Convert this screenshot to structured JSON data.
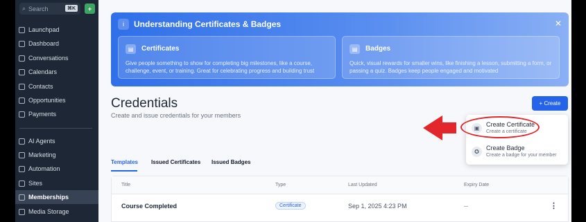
{
  "sidebar": {
    "search_placeholder": "Search",
    "search_shortcut": "⌘K",
    "add_button": "+",
    "items": [
      {
        "label": "Launchpad",
        "icon": "rocket-icon"
      },
      {
        "label": "Dashboard",
        "icon": "dashboard-icon"
      },
      {
        "label": "Conversations",
        "icon": "chat-icon"
      },
      {
        "label": "Calendars",
        "icon": "calendar-icon"
      },
      {
        "label": "Contacts",
        "icon": "contacts-icon"
      },
      {
        "label": "Opportunities",
        "icon": "opportunities-icon"
      },
      {
        "label": "Payments",
        "icon": "payments-icon"
      },
      {
        "label": "AI Agents",
        "icon": "ai-agent-icon"
      },
      {
        "label": "Marketing",
        "icon": "marketing-icon"
      },
      {
        "label": "Automation",
        "icon": "automation-icon"
      },
      {
        "label": "Sites",
        "icon": "sites-icon"
      },
      {
        "label": "Memberships",
        "icon": "memberships-icon",
        "active": true
      },
      {
        "label": "Media Storage",
        "icon": "media-icon"
      }
    ]
  },
  "banner": {
    "title": "Understanding Certificates & Badges",
    "close": "✕",
    "cards": [
      {
        "title": "Certificates",
        "desc": "Give people something to show for completing big milestones, like a course, challenge, event, or training. Great for celebrating progress and building trust"
      },
      {
        "title": "Badges",
        "desc": "Quick, visual rewards for smaller wins, like finishing a lesson, submitting a form, or passing a quiz. Badges keep people engaged and motivated"
      }
    ]
  },
  "page": {
    "title": "Credentials",
    "subtitle": "Create and issue credentials for your members",
    "create_button": "+ Create"
  },
  "dropdown": {
    "items": [
      {
        "title": "Create Certificate",
        "desc": "Create a certificate"
      },
      {
        "title": "Create Badge",
        "desc": "Create a badge for your member"
      }
    ]
  },
  "tabs": [
    "Templates",
    "Issued Certificates",
    "Issued Badges"
  ],
  "table": {
    "headers": [
      "Title",
      "Type",
      "Last Updated",
      "Expiry Date"
    ],
    "rows": [
      {
        "title": "Course Completed",
        "type": "Certificate",
        "updated": "Sep 1, 2025 4:23 PM",
        "expiry": "--",
        "menu": "⋮"
      }
    ]
  },
  "colors": {
    "accent": "#2563eb",
    "sidebar": "#1d2735",
    "highlight": "#e3262b"
  }
}
